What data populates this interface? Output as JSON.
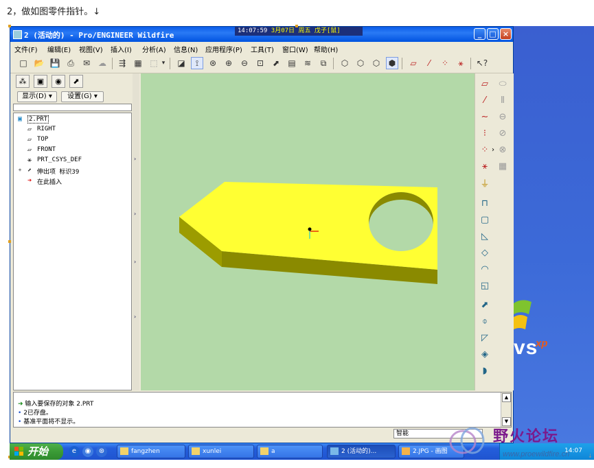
{
  "document": {
    "heading": "2，做如图零件指针。↓"
  },
  "window": {
    "title": "2 (活动的) - Pro/ENGINEER Wildfire",
    "clock_time": "14:07:59",
    "clock_date": "3月07日 周五",
    "clock_extra": "戊子[鼠]",
    "minimize": "_",
    "maximize": "□",
    "close": "×"
  },
  "menu": [
    "文件(F)",
    "编辑(E)",
    "视图(V)",
    "插入(I)",
    "分析(A)",
    "信息(N)",
    "应用程序(P)",
    "工具(T)",
    "窗口(W)",
    "帮助(H)"
  ],
  "toolbar_icons": [
    "new-file-icon",
    "open-folder-icon",
    "save-icon",
    "print-icon",
    "send-icon",
    "regenerate-icon",
    "datum-display-icon",
    "find-icon",
    "select-box-icon",
    "dropdown-icon",
    "repaint-icon",
    "spin-center-icon",
    "orient-icon",
    "zoom-in-icon",
    "zoom-out-icon",
    "fit-icon",
    "reorient-icon",
    "saved-views-icon",
    "layers-icon",
    "view-manager-icon",
    "wireframe-icon",
    "hidden-line-icon",
    "no-hidden-icon",
    "shading-icon",
    "datum-planes-icon",
    "datum-axes-icon",
    "datum-points-icon",
    "csys-icon",
    "context-help-icon"
  ],
  "model_tree": {
    "show_label": "显示(D) ▾",
    "settings_label": "设置(G) ▾",
    "nodes": [
      {
        "icon": "part-icon",
        "label": "2.PRT"
      },
      {
        "icon": "datum-plane-icon",
        "label": "RIGHT"
      },
      {
        "icon": "datum-plane-icon",
        "label": "TOP"
      },
      {
        "icon": "datum-plane-icon",
        "label": "FRONT"
      },
      {
        "icon": "csys-icon",
        "label": "PRT_CSYS_DEF"
      },
      {
        "icon": "extrude-icon",
        "label": "伸出项 标识39"
      },
      {
        "icon": "insert-here-icon",
        "label": "在此插入"
      }
    ]
  },
  "messages": [
    {
      "icon": "arrow-icon",
      "text": "输入要保存的对象   2.PRT"
    },
    {
      "icon": "bullet-icon",
      "text": "2已存盘。"
    },
    {
      "icon": "bullet-icon",
      "text": "基准平面将不显示。"
    }
  ],
  "status": {
    "filter": "智能"
  },
  "taskbar": {
    "start": "开始",
    "tasks": [
      {
        "label": "fangzhen",
        "icon": "folder-icon"
      },
      {
        "label": "xunlei",
        "icon": "folder-icon"
      },
      {
        "label": "a",
        "icon": "folder-icon"
      },
      {
        "label": "2 (活动的)...",
        "icon": "proe-icon"
      },
      {
        "label": "2.JPG - 画图",
        "icon": "paint-icon"
      }
    ],
    "tray_time": "14:07"
  },
  "watermark": {
    "text": "野火论坛",
    "url": "www.proewildfire.cn"
  },
  "colors": {
    "viewport_bg": "#b3d9a8",
    "part_top": "#ffff33",
    "part_side": "#8a8a00",
    "title_blue": "#0a5ce8"
  }
}
